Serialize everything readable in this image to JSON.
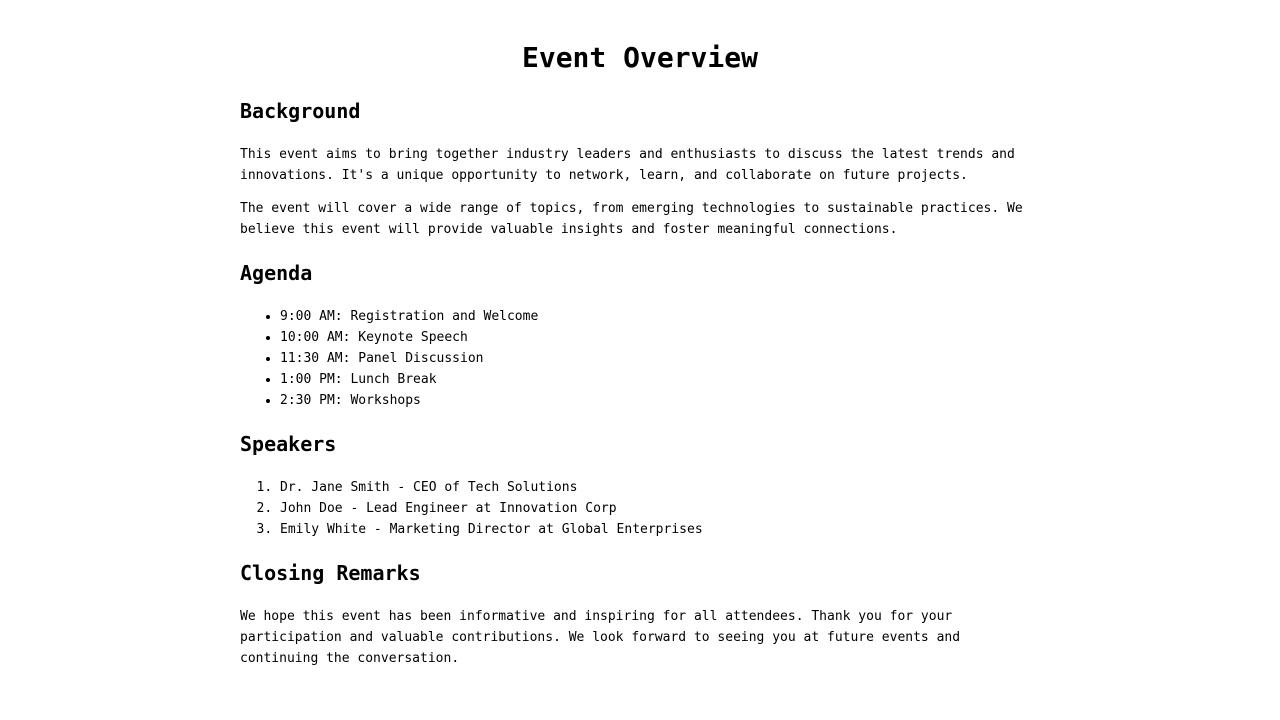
{
  "title": "Event Overview",
  "background": {
    "heading": "Background",
    "paragraphs": [
      "This event aims to bring together industry leaders and enthusiasts to discuss the latest trends and innovations. It's a unique opportunity to network, learn, and collaborate on future projects.",
      "The event will cover a wide range of topics, from emerging technologies to sustainable practices. We believe this event will provide valuable insights and foster meaningful connections."
    ]
  },
  "agenda": {
    "heading": "Agenda",
    "items": [
      "9:00 AM: Registration and Welcome",
      "10:00 AM: Keynote Speech",
      "11:30 AM: Panel Discussion",
      "1:00 PM: Lunch Break",
      "2:30 PM: Workshops"
    ]
  },
  "speakers": {
    "heading": "Speakers",
    "items": [
      "Dr. Jane Smith - CEO of Tech Solutions",
      "John Doe - Lead Engineer at Innovation Corp",
      "Emily White - Marketing Director at Global Enterprises"
    ]
  },
  "closing": {
    "heading": "Closing Remarks",
    "paragraph": "We hope this event has been informative and inspiring for all attendees. Thank you for your participation and valuable contributions. We look forward to seeing you at future events and continuing the conversation."
  }
}
